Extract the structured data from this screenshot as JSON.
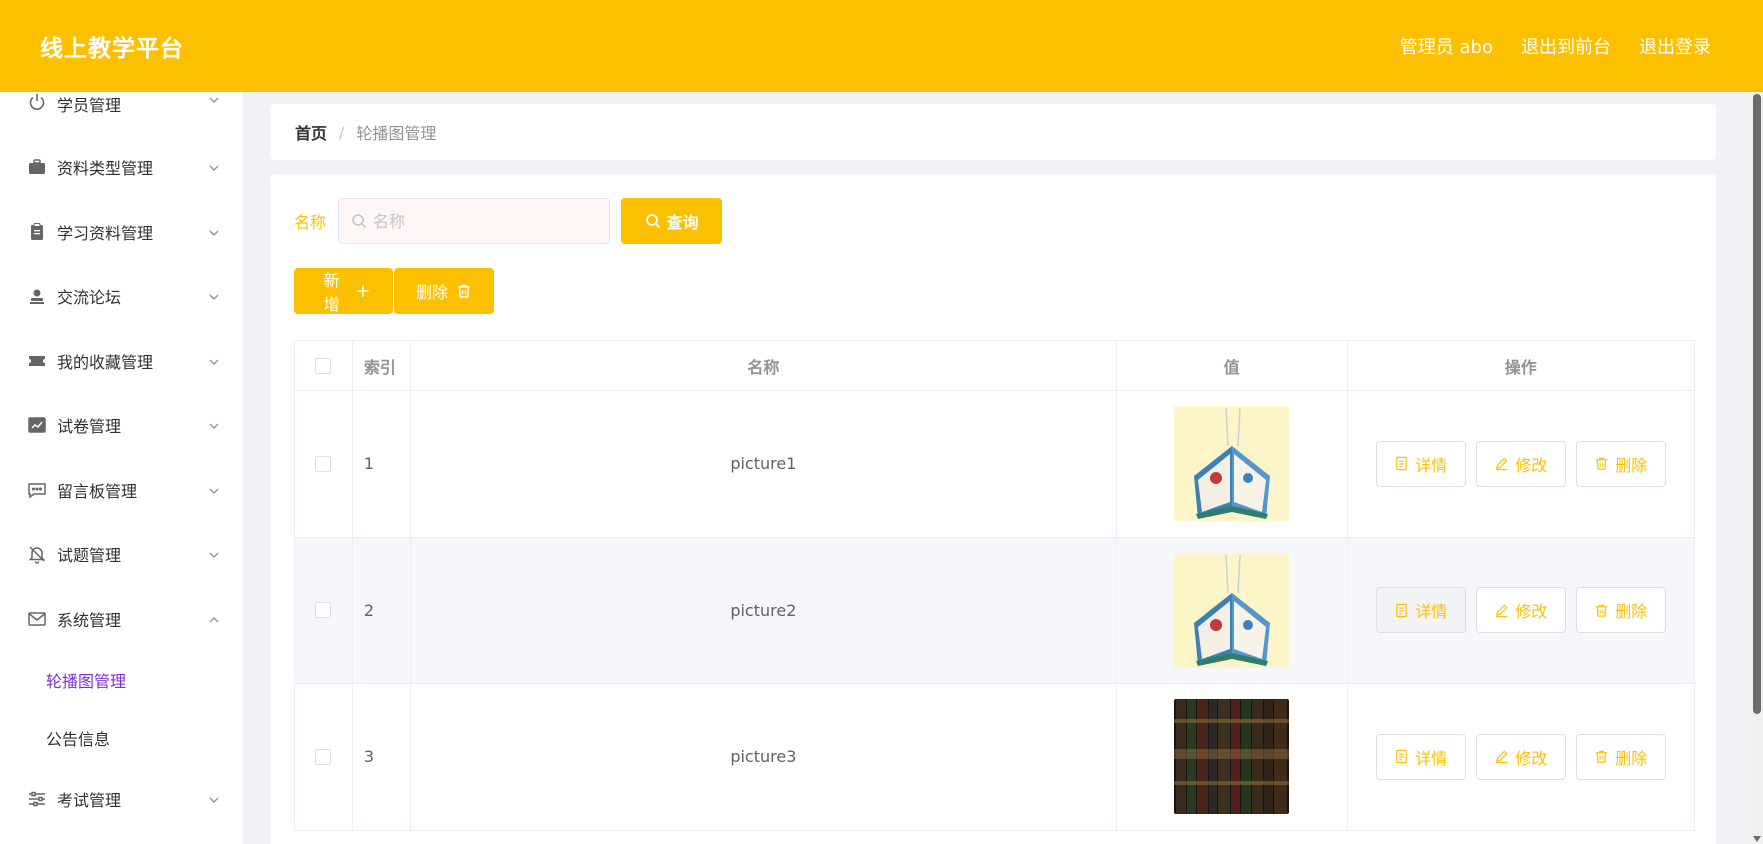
{
  "header": {
    "brand": "线上教学平台",
    "admin_label": "管理员 abo",
    "back_to_front": "退出到前台",
    "logout": "退出登录",
    "bg_color": "#fdc000"
  },
  "sidebar": {
    "items": [
      {
        "label": "学员管理",
        "icon": "power-icon"
      },
      {
        "label": "资料类型管理",
        "icon": "briefcase-icon"
      },
      {
        "label": "学习资料管理",
        "icon": "clipboard-icon"
      },
      {
        "label": "交流论坛",
        "icon": "user-stamp-icon"
      },
      {
        "label": "我的收藏管理",
        "icon": "ticket-icon"
      },
      {
        "label": "试卷管理",
        "icon": "chart-icon"
      },
      {
        "label": "留言板管理",
        "icon": "message-icon"
      },
      {
        "label": "试题管理",
        "icon": "bell-off-icon"
      },
      {
        "label": "系统管理",
        "icon": "mail-icon"
      }
    ],
    "sub_items": [
      {
        "label": "轮播图管理",
        "active": true
      },
      {
        "label": "公告信息",
        "active": false
      }
    ],
    "last_item": {
      "label": "考试管理",
      "icon": "sliders-icon"
    },
    "active_color": "#7c2fd6"
  },
  "breadcrumb": {
    "home": "首页",
    "separator": "/",
    "current": "轮播图管理"
  },
  "search": {
    "label": "名称",
    "placeholder": "名称",
    "query_button": "查询"
  },
  "actions": {
    "add_button": "新增",
    "delete_button": "删除"
  },
  "table": {
    "columns": [
      "索引",
      "名称",
      "值",
      "操作"
    ],
    "rows": [
      {
        "index": "1",
        "name": "picture1",
        "image": "book-image"
      },
      {
        "index": "2",
        "name": "picture2",
        "image": "book-image"
      },
      {
        "index": "3",
        "name": "picture3",
        "image": "bookshelf-image"
      }
    ],
    "op_labels": {
      "detail": "详情",
      "edit": "修改",
      "delete": "删除"
    }
  }
}
